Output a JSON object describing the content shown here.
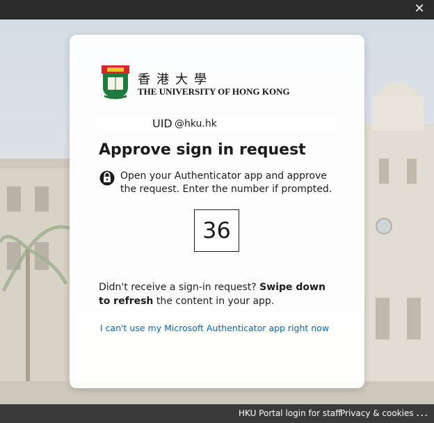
{
  "window": {
    "close_glyph": "✕"
  },
  "org": {
    "name_cn": "香港大學",
    "name_en": "THE UNIVERSITY OF HONG KONG",
    "crest_motto": "SAPIENTIA ET VIRTUS"
  },
  "account": {
    "uid": "UID",
    "domain": "@hku.hk"
  },
  "prompt": {
    "heading": "Approve sign in request",
    "instructions": "Open your Authenticator app and approve the request. Enter the number if prompted.",
    "number": "36",
    "no_request_prefix": "Didn't receive a sign-in request? ",
    "no_request_bold": "Swipe down to refresh",
    "no_request_suffix": " the content in your app.",
    "alternate_link": "I can't use my Microsoft Authenticator app right now"
  },
  "footer": {
    "portal_link": "HKU Portal login for staff",
    "privacy_link": "Privacy & cookies",
    "more": "..."
  },
  "icons": {
    "lock": "lock-icon",
    "close": "close-icon",
    "crest": "hku-crest-logo"
  },
  "colors": {
    "link": "#0067b8",
    "titlebar": "#2b2b2b",
    "footer": "#3a3a3a"
  }
}
